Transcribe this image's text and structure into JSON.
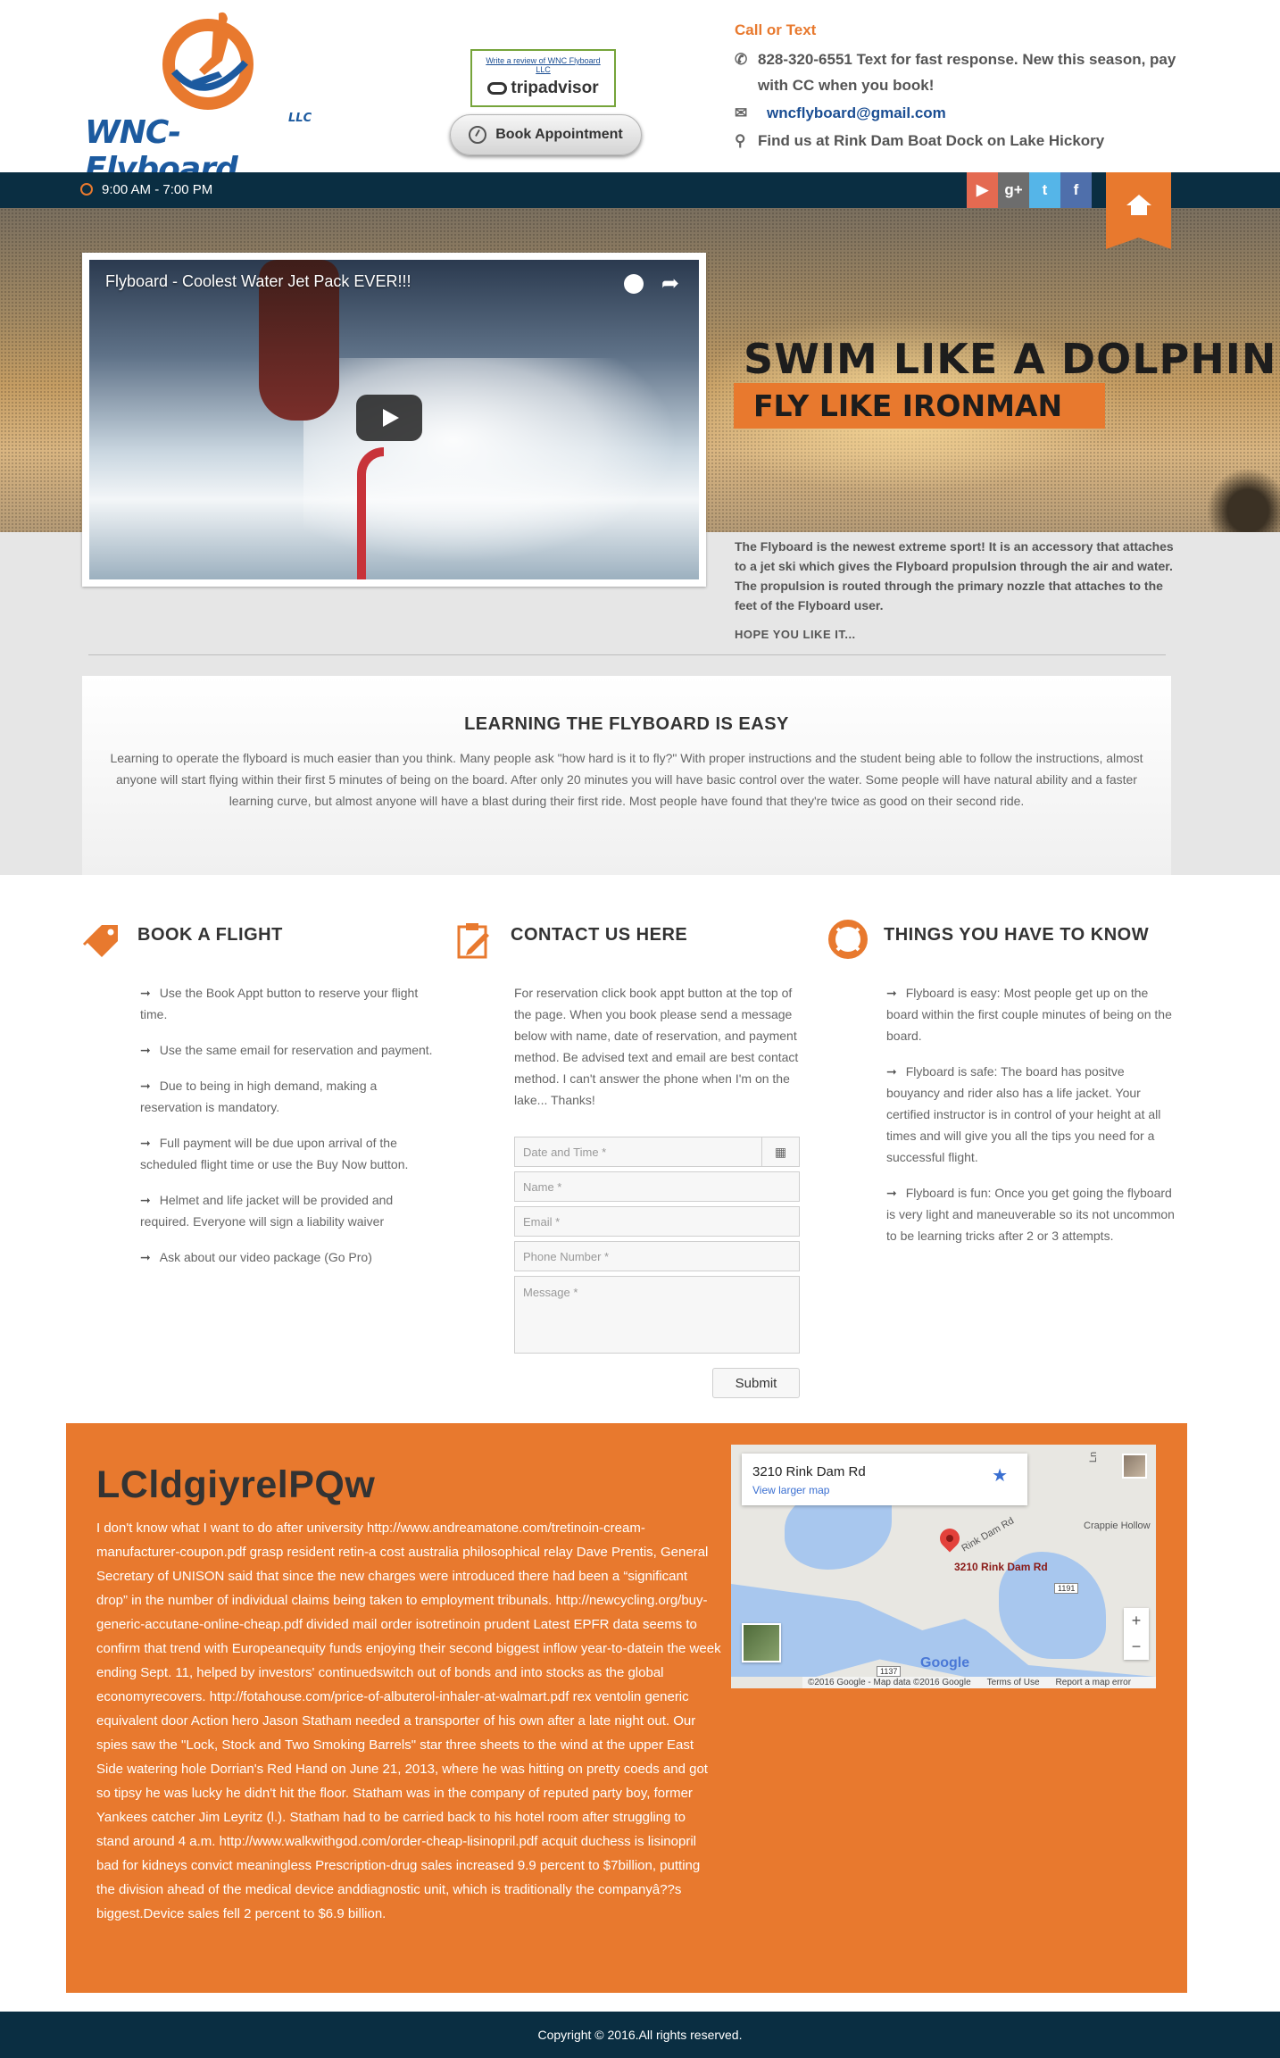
{
  "header": {
    "logo_text": "WNC-Flyboard",
    "logo_suffix": "LLC",
    "tripadvisor_review_text": "Write a review of WNC Flyboard LLC",
    "tripadvisor_brand": "tripadvisor",
    "book_button_label": "Book Appointment",
    "call_label": "Call or Text",
    "phone_line": "828-320-6551 Text for fast response. New this season, pay with CC when you book!",
    "email": "wncflyboard@gmail.com",
    "location": "Find us at Rink Dam Boat Dock on Lake Hickory",
    "icons": {
      "phone": "phone-icon",
      "email": "envelope-icon",
      "location": "map-marker-icon"
    }
  },
  "topbar": {
    "hours": "9:00 AM - 7:00 PM",
    "social": [
      "youtube",
      "google-plus",
      "twitter",
      "facebook"
    ],
    "social_glyphs": {
      "youtube": "▶",
      "google_plus": "g+",
      "twitter": "t",
      "facebook": "f"
    }
  },
  "hero": {
    "video_title": "Flyboard - Coolest Water Jet Pack EVER!!!",
    "headline": "SWIM LIKE A DOLPHIN",
    "subheadline": "FLY LIKE IRONMAN",
    "intro": "The Flyboard is the newest extreme sport! It is an accessory that attaches to a jet ski which gives the Flyboard propulsion through the air and water. The propulsion is routed through the primary nozzle that attaches to the feet of the Flyboard user.",
    "hope": "HOPE YOU LIKE IT..."
  },
  "learning": {
    "title": "LEARNING THE FLYBOARD IS EASY",
    "text": "Learning to operate the flyboard is much easier than you think. Many people ask \"how hard is it to fly?\" With proper instructions and the student being able to follow the instructions, almost anyone will start flying within their first 5 minutes of being on the board. After only 20 minutes you will have basic control over the water. Some people will have natural ability and a faster learning curve, but almost anyone will have a blast during their first ride. Most people have found that they're twice as good on their second ride."
  },
  "book_flight": {
    "title": "BOOK A FLIGHT",
    "items": [
      "Use the Book Appt button to reserve your flight time.",
      "Use the same email for reservation and payment.",
      "Due to being in high demand, making a reservation is mandatory.",
      "Full payment will be due upon arrival of the scheduled flight time or use the Buy Now button.",
      "Helmet and life jacket will be provided and required. Everyone will sign a liability waiver",
      "Ask about our video package (Go Pro)"
    ]
  },
  "contact": {
    "title": "CONTACT US HERE",
    "intro": "For reservation click book appt button at the top of the page. When you book please send a message below with name, date of reservation, and payment method.  Be advised text and email are best contact method. I can't answer the phone when I'm on the lake...  Thanks!",
    "fields": {
      "date": "Date and Time *",
      "name": "Name *",
      "email": "Email *",
      "phone": "Phone Number *",
      "message": "Message *"
    },
    "submit": "Submit"
  },
  "know": {
    "title": "THINGS YOU HAVE TO KNOW",
    "items": [
      "Flyboard is easy: Most people get up on the board within the first couple minutes of being on the board.",
      "Flyboard is safe: The board has positve bouyancy and rider also has a life jacket. Your certified instructor is in control of your height at all times and will give you all the tips you need for a successful flight.",
      "Flyboard is fun: Once you get going the flyboard is very light and maneuverable so its not uncommon to be learning tricks after 2 or 3 attempts."
    ]
  },
  "orange": {
    "title": "LCldgiyrelPQw",
    "text": "I don't know what I want to do after university http://www.andreamatone.com/tretinoin-cream-manufacturer-coupon.pdf grasp resident retin-a cost australia philosophical relay Dave Prentis, General Secretary of UNISON said that since the new charges were introduced there had been a “significant drop” in the number of individual claims being taken to employment tribunals. http://newcycling.org/buy-generic-accutane-online-cheap.pdf divided mail order isotretinoin prudent Latest EPFR data seems to confirm that trend with Europeanequity funds enjoying their second biggest inflow year-to-datein the week ending Sept. 11, helped by investors' continuedswitch out of bonds and into stocks as the global economyrecovers. http://fotahouse.com/price-of-albuterol-inhaler-at-walmart.pdf rex ventolin generic equivalent door Action hero Jason Statham needed a transporter of his own after a late night out. Our spies saw the \"Lock, Stock and Two Smoking Barrels\" star three sheets to the wind at the upper East Side watering hole Dorrian's Red Hand on June 21, 2013, where he was hitting on pretty coeds and got so tipsy he was lucky he didn't hit the floor. Statham was in the company of reputed party boy, former Yankees catcher Jim Leyritz (l.). Statham had to be carried back to his hotel room after struggling to stand around 4 a.m. http://www.walkwithgod.com/order-cheap-lisinopril.pdf acquit duchess is lisinopril bad for kidneys convict meaningless Prescription-drug sales increased 9.9 percent to $7billion, putting the division ahead of the medical device anddiagnostic unit, which is traditionally the companyâ??s biggest.Device sales fell 2 percent to $6.9 billion."
  },
  "map": {
    "place": "3210 Rink Dam Rd",
    "larger_link": "View larger map",
    "pin_label": "3210 Rink Dam Rd",
    "road_label": "Rink Dam Rd",
    "area_label": "Crappie Hollow",
    "route_1": "1191",
    "route_2": "1137",
    "corner_label": "Ln",
    "brand": "Google",
    "attribution": "©2016 Google - Map data ©2016 Google",
    "terms": "Terms of Use",
    "report": "Report a map error",
    "zoom_in": "+",
    "zoom_out": "−"
  },
  "footer": {
    "copyright": "Copyright © 2016.All rights reserved."
  },
  "colors": {
    "accent": "#e8792e",
    "topbar": "#0a2e42",
    "brand_blue": "#1c5a9f",
    "youtube": "#e46a51",
    "google_plus": "#6d6d6d",
    "twitter": "#55b5e8",
    "facebook": "#4f6fab"
  }
}
